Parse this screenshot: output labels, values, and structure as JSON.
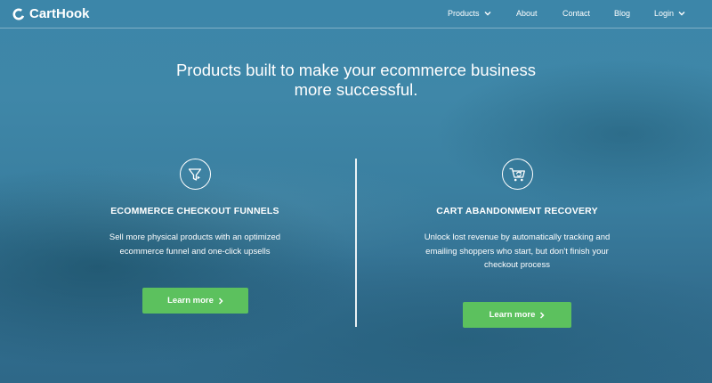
{
  "brand": {
    "name": "CartHook"
  },
  "nav": {
    "products": "Products",
    "about": "About",
    "contact": "Contact",
    "blog": "Blog",
    "login": "Login"
  },
  "hero": {
    "line1": "Products built to make your ecommerce business",
    "line2": "more successful."
  },
  "features": [
    {
      "icon": "funnel-icon",
      "title": "ECOMMERCE CHECKOUT FUNNELS",
      "desc": "Sell more physical products with an optimized ecommerce funnel and one-click upsells",
      "button": "Learn more"
    },
    {
      "icon": "cart-recovery-icon",
      "title": "CART ABANDONMENT RECOVERY",
      "desc": "Unlock lost revenue by automatically tracking and emailing shoppers who start, but don't finish your checkout process",
      "button": "Learn more"
    }
  ],
  "colors": {
    "accent": "#5cc15e",
    "background": "#3a7fa0"
  }
}
